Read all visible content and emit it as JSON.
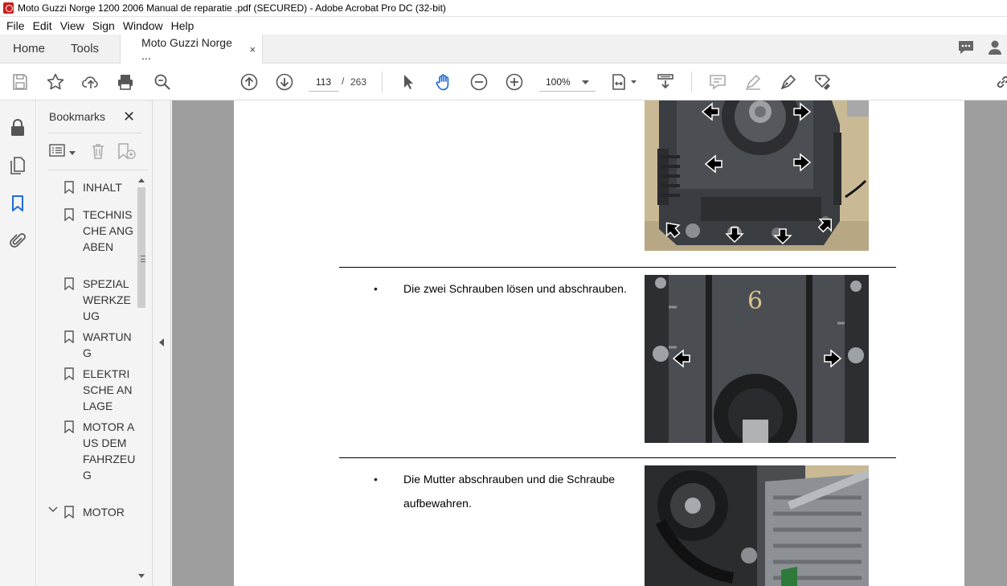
{
  "window": {
    "title": "Moto Guzzi Norge 1200 2006 Manual de reparatie  .pdf (SECURED) - Adobe Acrobat Pro DC (32-bit)"
  },
  "menu": [
    "File",
    "Edit",
    "View",
    "Sign",
    "Window",
    "Help"
  ],
  "tabs": {
    "home": "Home",
    "tools": "Tools",
    "document": "Moto Guzzi Norge ...",
    "close": "×"
  },
  "toolbar": {
    "current_page": "113",
    "page_separator": "/",
    "total_pages": "263",
    "zoom": "100%"
  },
  "bookmarks_panel": {
    "title": "Bookmarks",
    "close": "✕",
    "items": [
      {
        "label": "INHALT",
        "expanded": false
      },
      {
        "label": "TECHNISCHE ANGABEN",
        "expanded": false
      },
      {
        "label": "SPEZIALWERKZEUG",
        "expanded": false
      },
      {
        "label": "WARTUNG",
        "expanded": false
      },
      {
        "label": "ELEKTRISCHE ANLAGE",
        "expanded": false
      },
      {
        "label": "MOTOR AUS DEM FAHRZEUG",
        "expanded": false
      },
      {
        "label": "MOTOR",
        "expanded": true
      }
    ]
  },
  "document": {
    "bullet": "•",
    "steps": [
      {
        "text": "Die zwei Schrauben lösen und abschrauben."
      },
      {
        "text": "Die Mutter abschrauben und die Schraube aufbewahren."
      }
    ],
    "photo_label": "6"
  },
  "colors": {
    "accent_blue": "#1f6bd8",
    "acrobat_red": "#c91f1f",
    "viewport_gray": "#9e9e9e"
  }
}
